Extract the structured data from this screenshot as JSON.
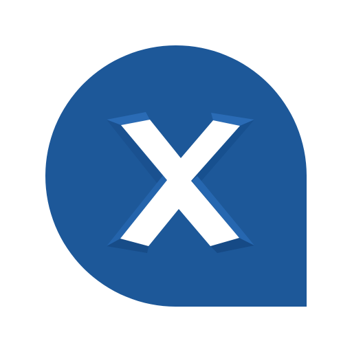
{
  "logo": {
    "icon": "x-speech-bubble-icon",
    "letter": "X",
    "colors": {
      "bubble": "#1d5899",
      "bevel_dark": "#144a86",
      "bevel_light": "#2a6bb5",
      "letter": "#ffffff",
      "background": "#ffffff"
    }
  }
}
